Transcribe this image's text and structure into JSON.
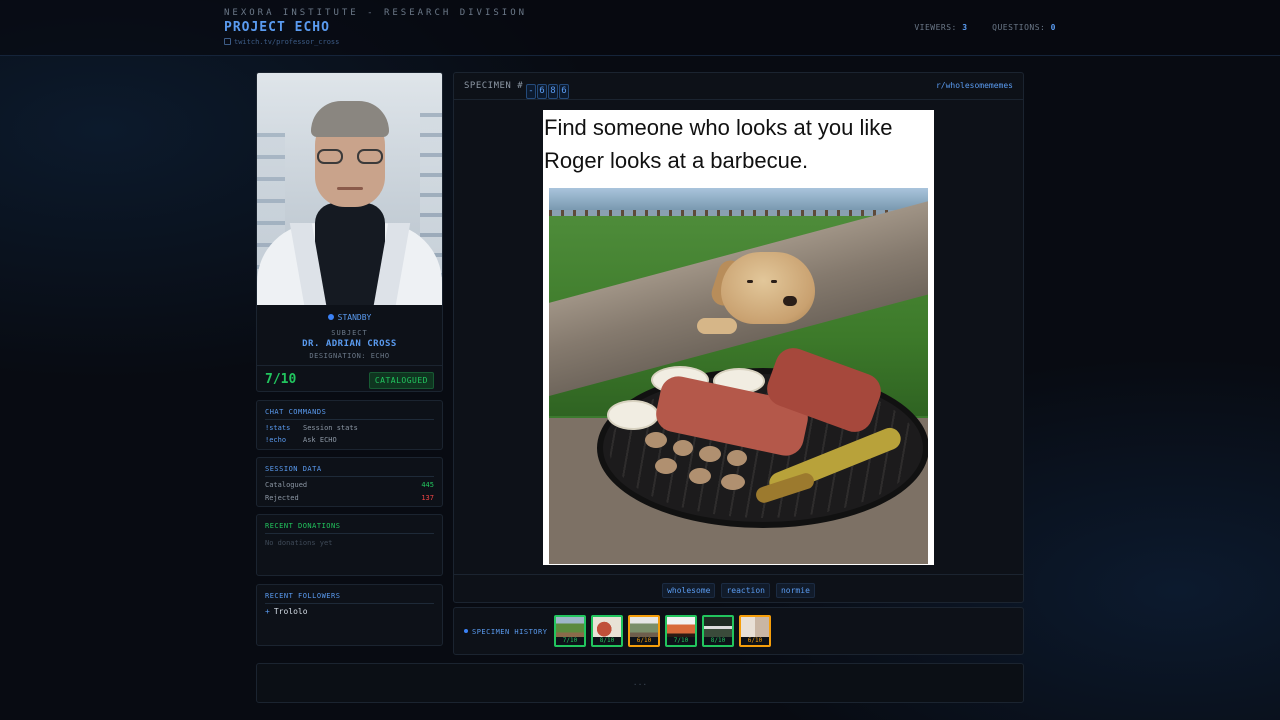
{
  "header": {
    "org": "NEXORA INSTITUTE - RESEARCH DIVISION",
    "project": "PROJECT ECHO",
    "channel_icon": "stream-icon",
    "channel": "twitch.tv/professor_cross",
    "viewers_label": "VIEWERS:",
    "viewers_value": "3",
    "questions_label": "QUESTIONS:",
    "questions_value": "0"
  },
  "profile": {
    "status": "STANDBY",
    "subject_label": "SUBJECT",
    "subject_name": "DR. ADRIAN CROSS",
    "designation": "DESIGNATION: ECHO",
    "score": "7/10",
    "verdict": "CATALOGUED"
  },
  "commands": {
    "title": "CHAT COMMANDS",
    "items": [
      {
        "cmd": "!stats",
        "desc": "Session stats"
      },
      {
        "cmd": "!echo",
        "desc": "Ask ECHO"
      }
    ]
  },
  "session": {
    "title": "SESSION DATA",
    "catalogued_label": "Catalogued",
    "catalogued_value": "445",
    "rejected_label": "Rejected",
    "rejected_value": "137"
  },
  "donations": {
    "title": "RECENT DONATIONS",
    "empty": "No donations yet"
  },
  "followers": {
    "title": "RECENT FOLLOWERS",
    "items": [
      "Trololo"
    ]
  },
  "specimen": {
    "label": "SPECIMEN #",
    "digits": [
      "-",
      "6",
      "8",
      "6"
    ],
    "subreddit": "r/wholesomememes",
    "caption_line1": "Find someone who looks at you like",
    "caption_line2": "Roger looks at a barbecue.",
    "tags": [
      "wholesome",
      "reaction",
      "normie"
    ]
  },
  "history": {
    "label": "SPECIMEN HISTORY",
    "items": [
      {
        "score": "7/10",
        "status": "accepted",
        "color": "#22c55e"
      },
      {
        "score": "8/10",
        "status": "accepted",
        "color": "#22c55e"
      },
      {
        "score": "6/10",
        "status": "rejected",
        "color": "#f59e0b"
      },
      {
        "score": "7/10",
        "status": "accepted",
        "color": "#22c55e"
      },
      {
        "score": "8/10",
        "status": "accepted",
        "color": "#22c55e"
      },
      {
        "score": "6/10",
        "status": "rejected",
        "color": "#f59e0b"
      }
    ]
  },
  "bottom_bar": {
    "text": "..."
  },
  "colors": {
    "accent": "#5a9bf0",
    "success": "#22c55e",
    "danger": "#ef4444",
    "warning": "#f59e0b",
    "background": "#080b12"
  }
}
